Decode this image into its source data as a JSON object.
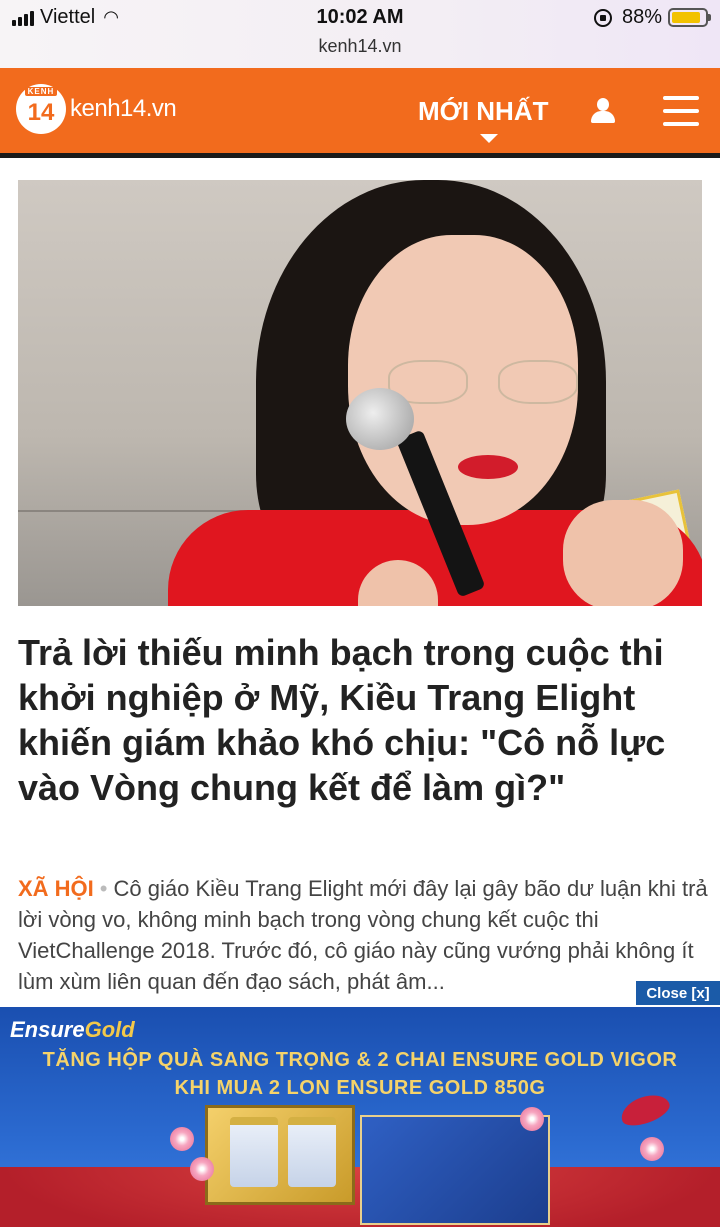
{
  "status_bar": {
    "carrier": "Viettel",
    "time": "10:02 AM",
    "url": "kenh14.vn",
    "battery": "88%",
    "battery_level": 0.88
  },
  "header": {
    "logo_badge_label": "KENH",
    "logo_badge_number": "14",
    "logo_text": "kenh14.vn",
    "nav_label": "MỚI NHẤT",
    "accent_color": "#f26b1d"
  },
  "article": {
    "headline": "Trả lời thiếu minh bạch trong cuộc thi khởi nghiệp ở Mỹ, Kiều Trang Elight khiến giám khảo khó chịu: \"Cô nỗ lực vào Vòng chung kết để làm gì?\"",
    "category": "XÃ HỘI",
    "separator": "•",
    "summary": "Cô giáo Kiều Trang Elight mới đây lại gây bão dư luận khi trả lời vòng vo, không minh bạch trong vòng chung kết cuộc thi VietChallenge 2018. Trước đó, cô giáo này cũng vướng phải không ít lùm xùm liên quan đến đạo sách, phát âm..."
  },
  "ad": {
    "close_label": "Close [x]",
    "brand_prefix": "Ensure",
    "brand_suffix": "Gold",
    "line1": "TẶNG HỘP QUÀ SANG TRỌNG & 2 CHAI ENSURE GOLD VIGOR",
    "line2": "KHI MUA 2 LON ENSURE GOLD 850G"
  }
}
